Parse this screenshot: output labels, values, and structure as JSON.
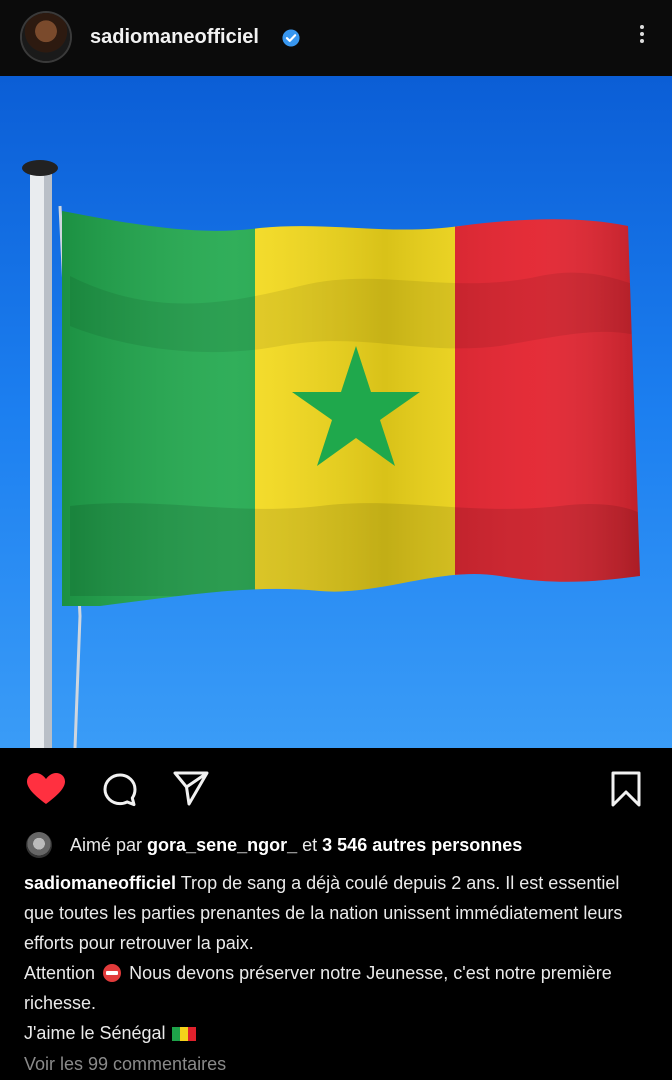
{
  "post": {
    "username": "sadiomaneofficiel",
    "verified": true
  },
  "icons": {
    "avatar": "profile-photo",
    "verified": "verified-badge-icon",
    "more": "more-vertical-icon",
    "like": "heart-filled-icon",
    "comment": "comment-icon",
    "share": "send-icon",
    "save": "bookmark-icon"
  },
  "image": {
    "subject": "senegal-flag",
    "colors": [
      "#1ea34a",
      "#f4d21a",
      "#e0212c",
      "#1e7ff0"
    ]
  },
  "likes": {
    "prefix": "Aimé par",
    "user": "gora_sene_ngor_",
    "connector": "et",
    "count_text": "3 546 autres personnes"
  },
  "caption": {
    "author": "sadiomaneofficiel",
    "line1": "Trop de sang a déjà coulé depuis 2 ans. Il est essentiel que toutes les parties prenantes de la nation unissent immédiatement leurs efforts pour retrouver la paix.",
    "attention": "Attention",
    "line2": "Nous devons préserver notre Jeunesse, c'est notre première richesse.",
    "line3": "J'aime le Sénégal"
  },
  "comments": {
    "link": "Voir les 99 commentaires"
  },
  "colors": {
    "background": "#000000",
    "like_red": "#ff3040",
    "verified_blue": "#3897f0",
    "muted_text": "#8a8a8a"
  }
}
